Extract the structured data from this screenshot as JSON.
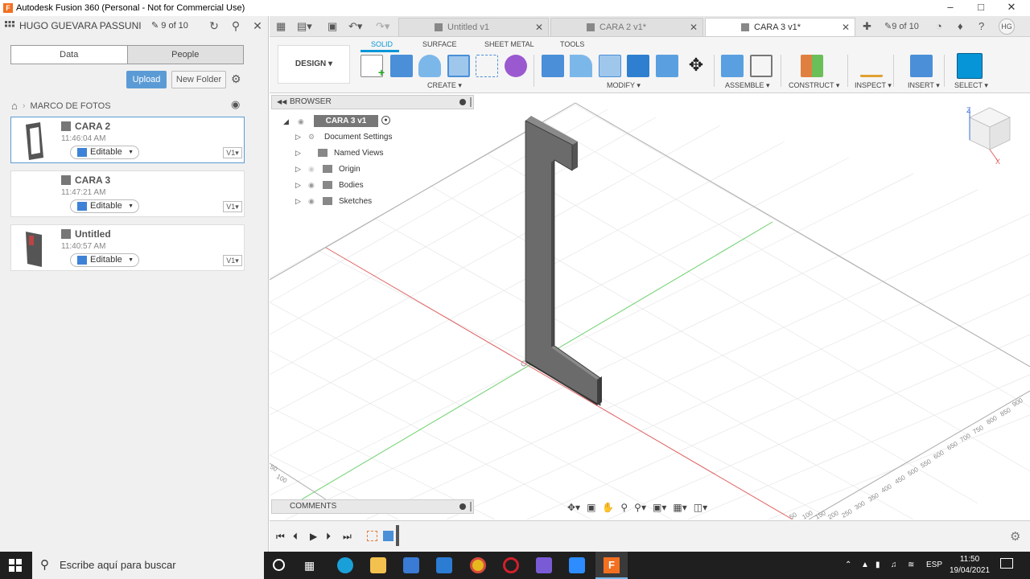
{
  "window": {
    "title": "Autodesk Fusion 360 (Personal - Not for Commercial Use)",
    "minimize_icon": "minimize-icon",
    "maximize_icon": "maximize-icon",
    "close_icon": "close-icon"
  },
  "data_panel": {
    "user": "HUGO GUEVARA PASSUNI",
    "version_count": "9 of 10",
    "tabs": [
      "Data",
      "People"
    ],
    "upload_label": "Upload",
    "new_folder_label": "New Folder",
    "breadcrumb": "MARCO DE FOTOS",
    "files": [
      {
        "name": "CARA 2",
        "time": "11:46:04 AM",
        "status": "Editable",
        "version": "V1"
      },
      {
        "name": "CARA 3",
        "time": "11:47:21 AM",
        "status": "Editable",
        "version": "V1"
      },
      {
        "name": "Untitled",
        "time": "11:40:57 AM",
        "status": "Editable",
        "version": "V1"
      }
    ]
  },
  "doc_tabs": [
    {
      "label": "Untitled v1",
      "active": false
    },
    {
      "label": "CARA 2 v1*",
      "active": false
    },
    {
      "label": "CARA 3 v1*",
      "active": true
    }
  ],
  "top_right": {
    "version_count": "9 of 10",
    "avatar": "HG"
  },
  "ribbon": {
    "workspace": "DESIGN",
    "tabs": [
      "SOLID",
      "SURFACE",
      "SHEET METAL",
      "TOOLS"
    ],
    "groups": [
      "CREATE",
      "MODIFY",
      "ASSEMBLE",
      "CONSTRUCT",
      "INSPECT",
      "INSERT",
      "SELECT"
    ]
  },
  "browser": {
    "title": "BROWSER",
    "root": "CARA 3 v1",
    "items": [
      "Document Settings",
      "Named Views",
      "Origin",
      "Bodies",
      "Sketches"
    ]
  },
  "comments_label": "COMMENTS",
  "axis_ticks": [
    "900",
    "850",
    "800",
    "750",
    "700",
    "650",
    "600",
    "550",
    "500",
    "450",
    "400",
    "350",
    "300",
    "250",
    "200",
    "150",
    "100",
    "50",
    "100",
    "50"
  ],
  "taskbar": {
    "search_placeholder": "Escribe aquí para buscar",
    "lang": "ESP",
    "time": "11:50",
    "date": "19/04/2021"
  },
  "colors": {
    "accent": "#0696d7",
    "upload": "#5b9bd5",
    "body": "#6b6b6b",
    "x_axis": "#e06060",
    "y_axis": "#6bd06b"
  }
}
